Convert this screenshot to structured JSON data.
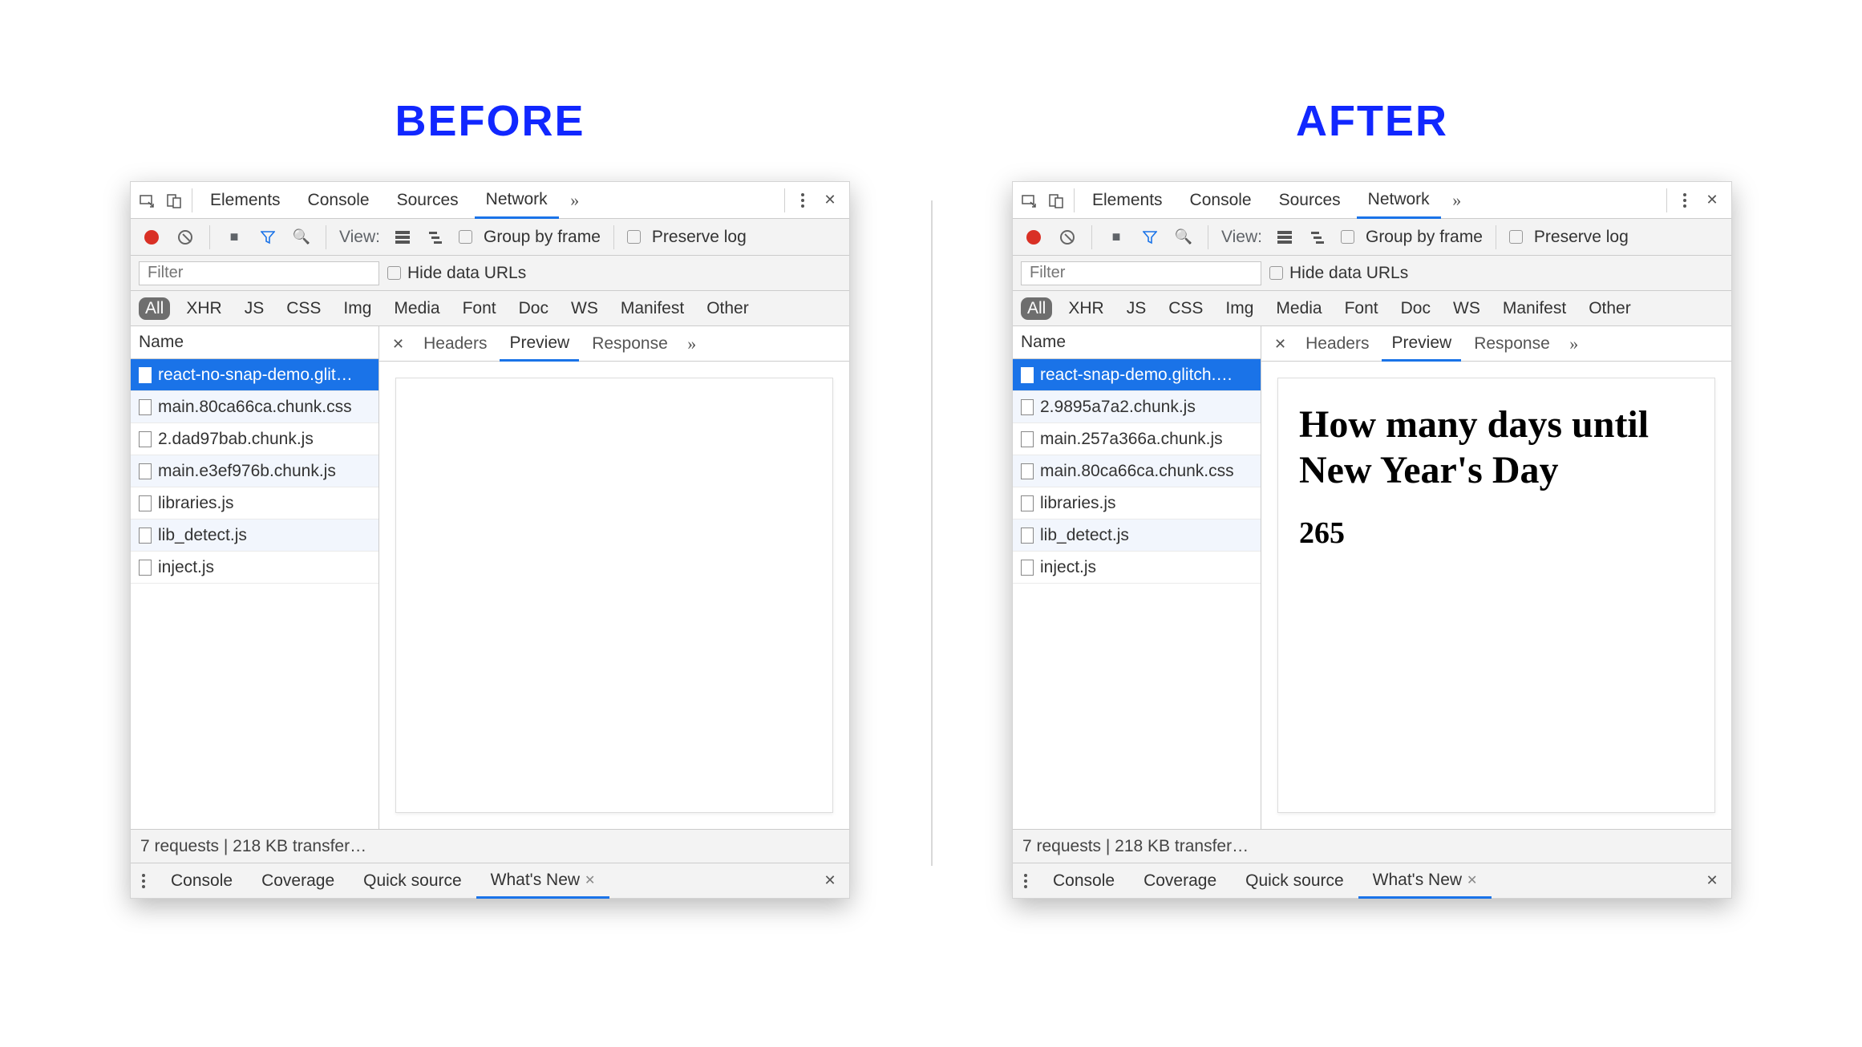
{
  "headings": {
    "before": "BEFORE",
    "after": "AFTER"
  },
  "tabs": {
    "elements": "Elements",
    "console": "Console",
    "sources": "Sources",
    "network": "Network"
  },
  "toolbar": {
    "view": "View:",
    "group_by_frame": "Group by frame",
    "preserve_log": "Preserve log"
  },
  "filter": {
    "placeholder": "Filter",
    "hide_data_urls": "Hide data URLs"
  },
  "types": {
    "all": "All",
    "xhr": "XHR",
    "js": "JS",
    "css": "CSS",
    "img": "Img",
    "media": "Media",
    "font": "Font",
    "doc": "Doc",
    "ws": "WS",
    "manifest": "Manifest",
    "other": "Other"
  },
  "reqheader": "Name",
  "detail_tabs": {
    "headers": "Headers",
    "preview": "Preview",
    "response": "Response"
  },
  "status": "7 requests | 218 KB transfer…",
  "drawer": {
    "console": "Console",
    "coverage": "Coverage",
    "quick_source": "Quick source",
    "whats_new": "What's New"
  },
  "before": {
    "requests": [
      "react-no-snap-demo.glit…",
      "main.80ca66ca.chunk.css",
      "2.dad97bab.chunk.js",
      "main.e3ef976b.chunk.js",
      "libraries.js",
      "lib_detect.js",
      "inject.js"
    ],
    "preview_html": {
      "title": "",
      "count": ""
    }
  },
  "after": {
    "requests": [
      "react-snap-demo.glitch.…",
      "2.9895a7a2.chunk.js",
      "main.257a366a.chunk.js",
      "main.80ca66ca.chunk.css",
      "libraries.js",
      "lib_detect.js",
      "inject.js"
    ],
    "preview_html": {
      "title": "How many days until New Year's Day",
      "count": "265"
    }
  }
}
